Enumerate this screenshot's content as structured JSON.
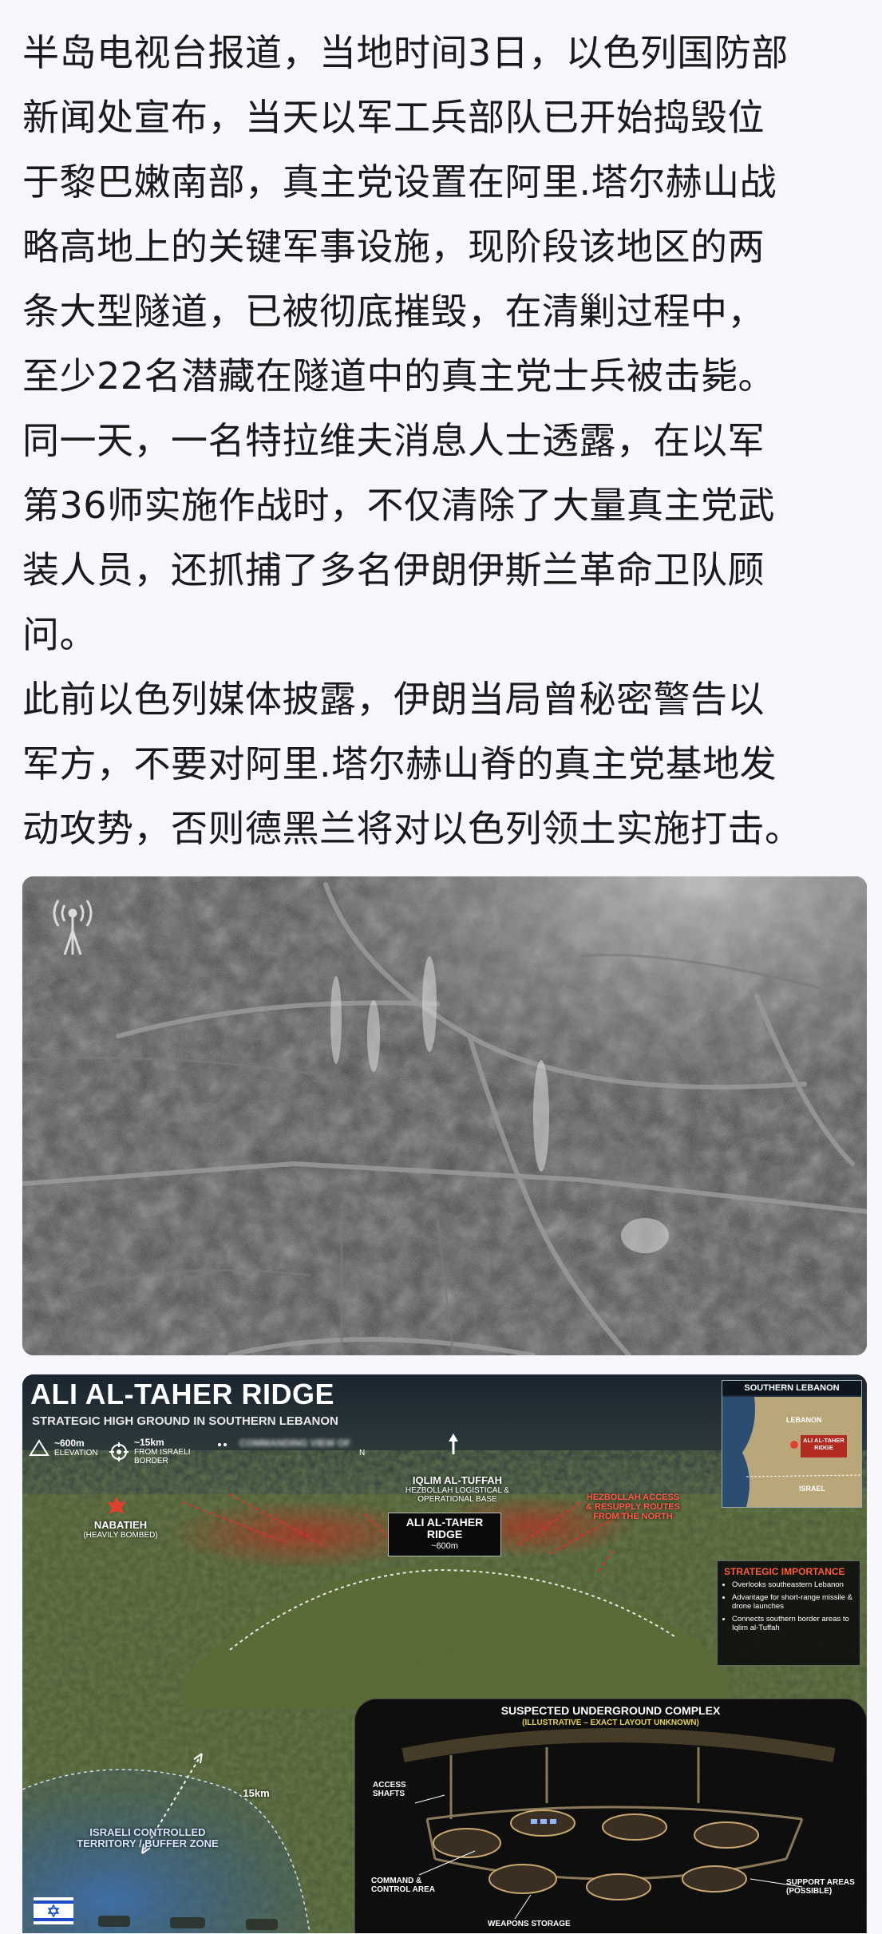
{
  "article": {
    "paragraphs": [
      "半岛电视台报道，当地时间3日，以色列国防部\n新闻处宣布，当天以军工兵部队已开始捣毁位\n于黎巴嫩南部，真主党设置在阿里.塔尔赫山战\n略高地上的关键军事设施，现阶段该地区的两\n条大型隧道，已被彻底摧毁，在清剿过程中，\n至少22名潜藏在隧道中的真主党士兵被击毙。\n同一天，一名特拉维夫消息人士透露，在以军\n第36师实施作战时，不仅清除了大量真主党武\n装人员，还抓捕了多名伊朗伊斯兰革命卫队顾\n问。",
      "此前以色列媒体披露，伊朗当局曾秘密警告以\n军方，不要对阿里.塔尔赫山脊的真主党基地发\n动攻势，否则德黑兰将对以色列领土实施打击。"
    ]
  },
  "figure1": {
    "icon": "antenna-broadcast-icon"
  },
  "infographic": {
    "title": "ALI AL-TAHER RIDGE",
    "subtitle": "STRATEGIC HIGH GROUND IN SOUTHERN LEBANON",
    "stats": [
      {
        "icon": "triangle-elevation-icon",
        "value": "~600m",
        "label": "ELEVATION"
      },
      {
        "icon": "crosshair-icon",
        "value": "~15km",
        "label": "FROM ISRAELI\nBORDER"
      },
      {
        "icon": "dots-icon",
        "value": "COMMANDING VIEW OF",
        "label": "N"
      }
    ],
    "iqlim": {
      "title": "IQLIM AL-TUFFAH",
      "sub": "HEZBOLLAH LOGISTICAL &\nOPERATIONAL BASE"
    },
    "nabatieh": {
      "title": "NABATIEH",
      "sub": "(HEAVILY BOMBED)"
    },
    "hezbollah_routes": "HEZBOLLAH ACCESS\n& RESUPPLY ROUTES\nFROM THE NORTH",
    "ridge_box": {
      "title": "ALI AL-TAHER RIDGE",
      "sub": "~600m"
    },
    "distance": "15km",
    "israeli_zone": "ISRAELI CONTROLLED\nTERRITORY / BUFFER ZONE",
    "mini_map": {
      "title": "SOUTHERN LEBANON",
      "lebanon": "LEBANON",
      "ridge": "ALI AL-TAHER\nRIDGE",
      "israel": "ISRAEL"
    },
    "strategic": {
      "title": "STRATEGIC IMPORTANCE",
      "items": [
        "Overlooks southeastern Lebanon",
        "Advantage for short-range missile & drone launches",
        "Connects southern border areas to Iqlim al-Tuffah"
      ]
    },
    "complex": {
      "title": "SUSPECTED UNDERGROUND COMPLEX",
      "sub": "(ILLUSTRATIVE – EXACT LAYOUT UNKNOWN)",
      "access": "ACCESS\nSHAFTS",
      "command": "COMMAND &\nCONTROL AREA",
      "weapons": "WEAPONS STORAGE",
      "support": "SUPPORT AREAS\n(POSSIBLE)"
    },
    "colors": {
      "accent_red": "#ff5a4a",
      "highlight_yellow": "#e6d44a"
    }
  }
}
